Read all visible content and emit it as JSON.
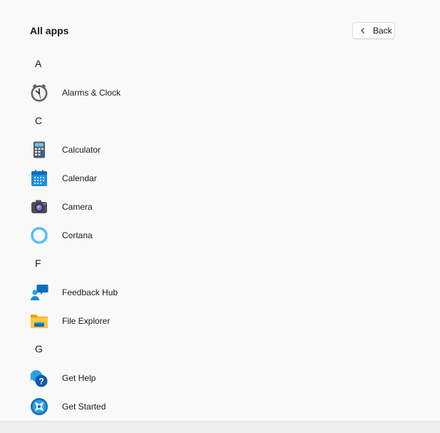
{
  "header": {
    "title": "All apps",
    "back_label": "Back"
  },
  "groups": [
    {
      "letter": "A",
      "apps": [
        {
          "label": "Alarms & Clock",
          "icon": "alarm-clock-icon"
        }
      ]
    },
    {
      "letter": "C",
      "apps": [
        {
          "label": "Calculator",
          "icon": "calculator-icon"
        },
        {
          "label": "Calendar",
          "icon": "calendar-icon"
        },
        {
          "label": "Camera",
          "icon": "camera-icon"
        },
        {
          "label": "Cortana",
          "icon": "cortana-icon"
        }
      ]
    },
    {
      "letter": "F",
      "apps": [
        {
          "label": "Feedback Hub",
          "icon": "feedback-hub-icon"
        },
        {
          "label": "File Explorer",
          "icon": "file-explorer-icon"
        }
      ]
    },
    {
      "letter": "G",
      "apps": [
        {
          "label": "Get Help",
          "icon": "get-help-icon"
        },
        {
          "label": "Get Started",
          "icon": "get-started-icon"
        }
      ]
    }
  ]
}
